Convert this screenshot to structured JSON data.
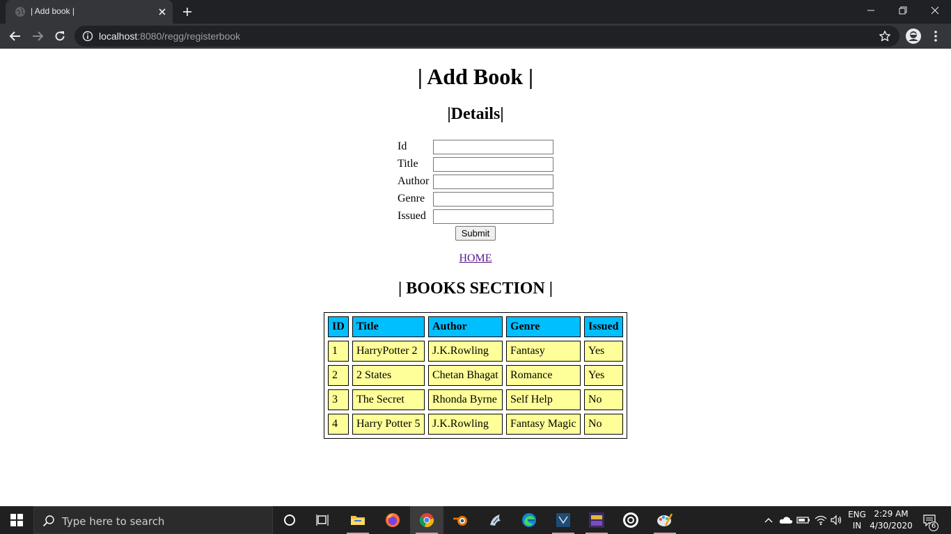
{
  "browser": {
    "tab_title": "| Add book |",
    "url_host": "localhost",
    "url_rest": ":8080/regg/registerbook",
    "icons": [
      "globe-icon",
      "close-icon",
      "plus-icon",
      "minimize-icon",
      "restore-icon",
      "window-close-icon",
      "back-arrow-icon",
      "forward-arrow-icon",
      "reload-icon",
      "info-icon",
      "star-icon",
      "profile-icon",
      "menu-dots-icon"
    ]
  },
  "page": {
    "title": "| Add Book |",
    "details_heading": "|Details|",
    "form": {
      "fields": [
        {
          "label": "Id",
          "value": ""
        },
        {
          "label": "Title",
          "value": ""
        },
        {
          "label": "Author",
          "value": ""
        },
        {
          "label": "Genre",
          "value": ""
        },
        {
          "label": "Issued",
          "value": ""
        }
      ],
      "submit_label": "Submit"
    },
    "home_link": "HOME",
    "books_heading": "| BOOKS SECTION |",
    "table": {
      "headers": [
        "ID",
        "Title",
        "Author",
        "Genre",
        "Issued"
      ],
      "rows": [
        [
          "1",
          "HarryPotter 2",
          "J.K.Rowling",
          "Fantasy",
          "Yes"
        ],
        [
          "2",
          "2 States",
          "Chetan Bhagat",
          "Romance",
          "Yes"
        ],
        [
          "3",
          "The Secret",
          "Rhonda Byrne",
          "Self Help",
          "No"
        ],
        [
          "4",
          "Harry Potter 5",
          "J.K.Rowling",
          "Fantasy Magic",
          "No"
        ]
      ],
      "header_color": "#00bfff",
      "cell_color": "#ffff99"
    }
  },
  "taskbar": {
    "search_placeholder": "Type here to search",
    "language_top": "ENG",
    "language_bottom": "IN",
    "time": "2:29 AM",
    "date": "4/30/2020",
    "notification_count": "6"
  }
}
